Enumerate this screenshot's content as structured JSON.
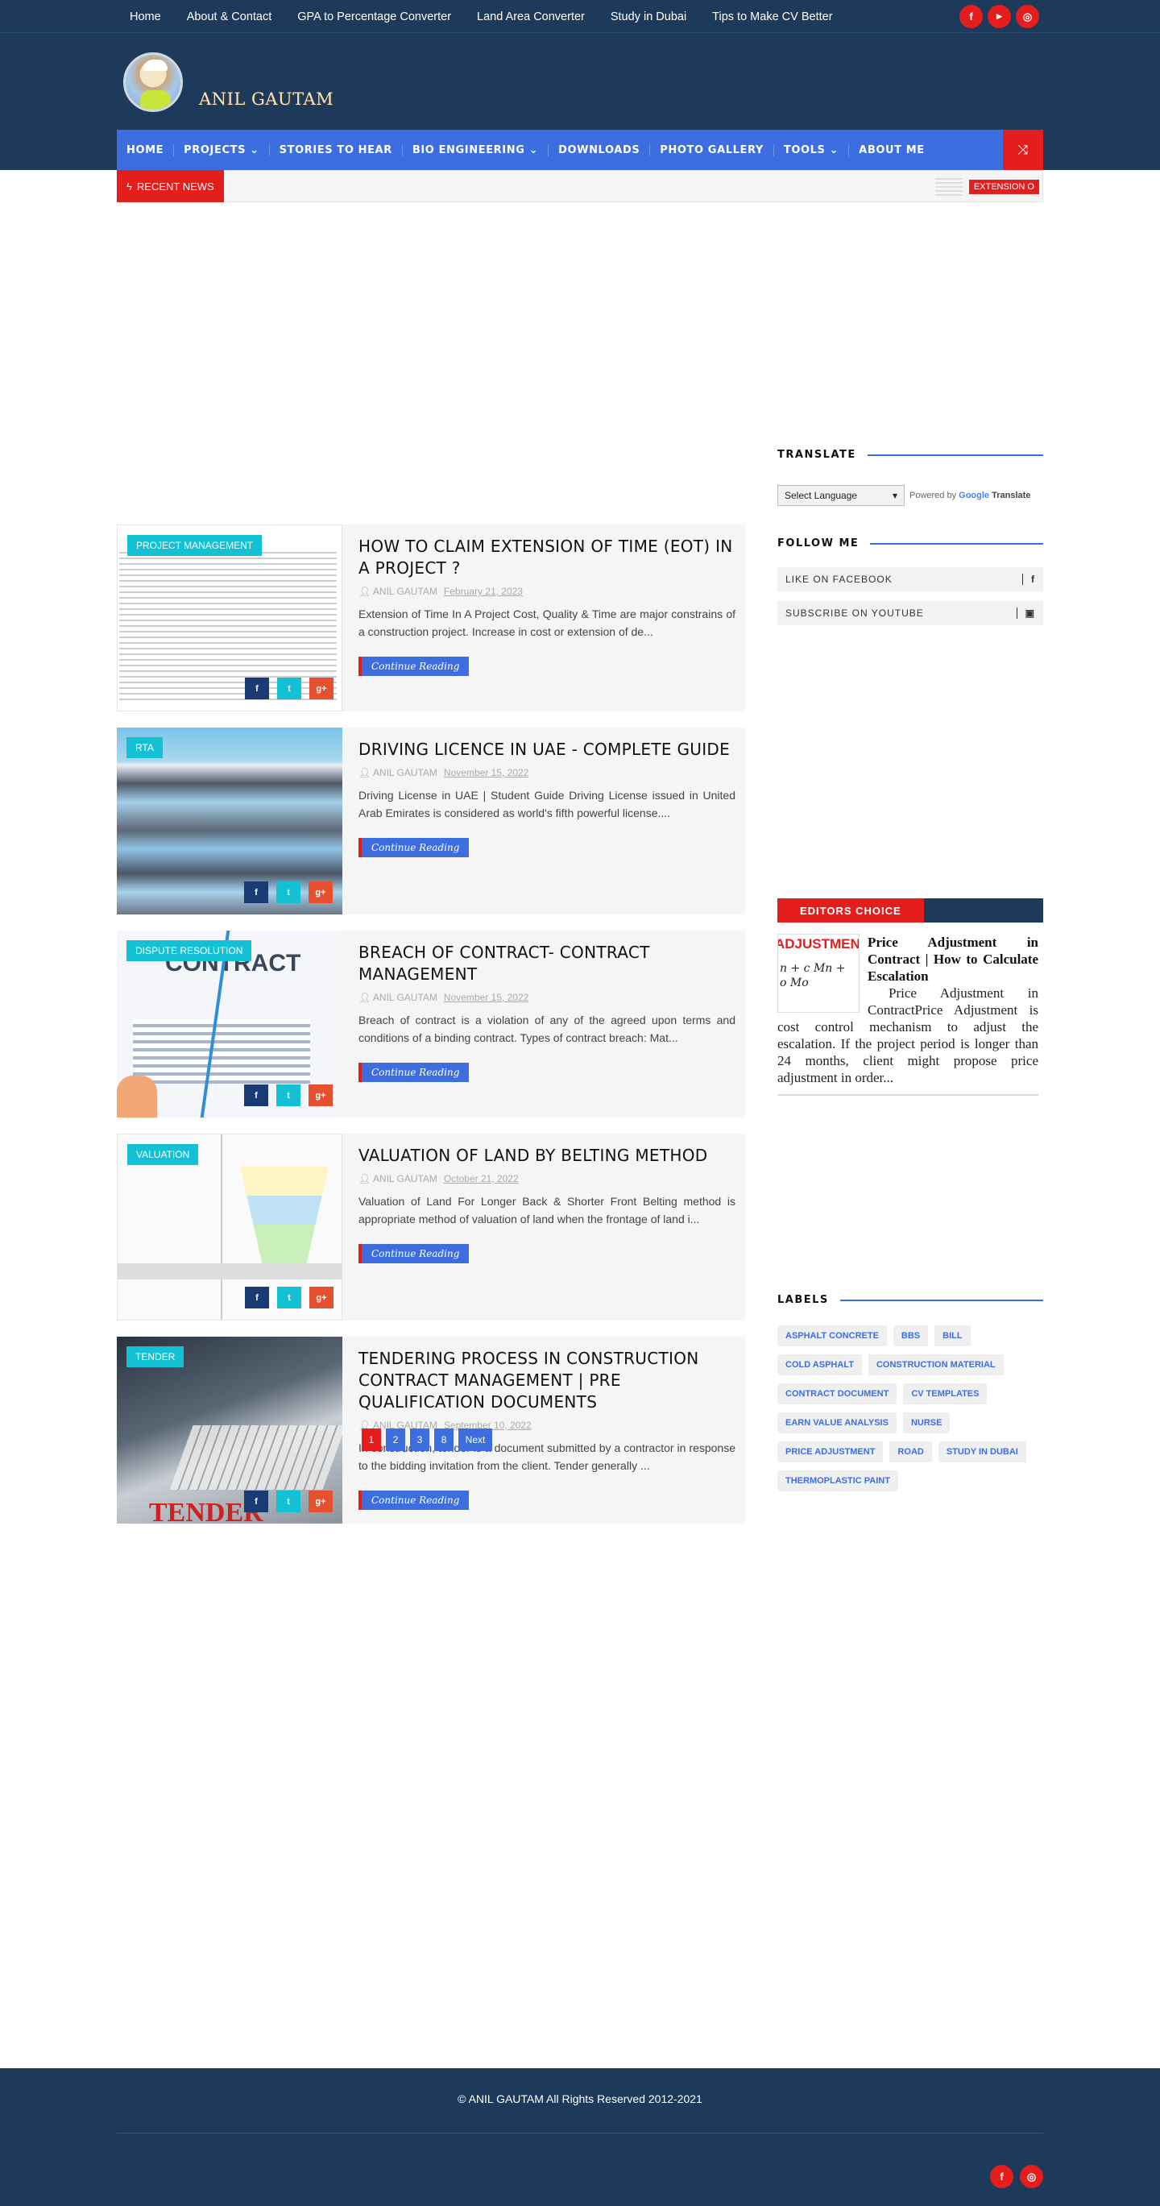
{
  "topbar": {
    "links": [
      "Home",
      "About & Contact",
      "GPA to Percentage Converter",
      "Land Area Converter",
      "Study in Dubai",
      "Tips to Make CV Better"
    ],
    "social": [
      {
        "icon": "facebook-icon",
        "glyph": "f"
      },
      {
        "icon": "youtube-icon",
        "glyph": "▶"
      },
      {
        "icon": "instagram-icon",
        "glyph": "◎"
      }
    ]
  },
  "header": {
    "site_name": "ANIL GAUTAM"
  },
  "nav": {
    "items": [
      "HOME",
      "PROJECTS ⌄",
      "STORIES TO HEAR",
      "BIO ENGINEERING ⌄",
      "DOWNLOADS",
      "PHOTO GALLERY",
      "TOOLS ⌄",
      "ABOUT ME"
    ],
    "shuffle_icon": "shuffle-icon"
  },
  "news": {
    "label": "RECENT NEWS",
    "ticker": "EXTENSION O"
  },
  "posts": [
    {
      "category": "PROJECT MANAGEMENT",
      "title": "HOW TO CLAIM EXTENSION OF TIME (EOT) IN A PROJECT ?",
      "author": "ANIL GAUTAM",
      "date": "February 21, 2023",
      "excerpt": "Extension of Time In A Project Cost, Quality & Time are major constrains of a construction project. Increase in cost or extension of de...",
      "more": "Continue Reading"
    },
    {
      "category": "RTA",
      "title": "DRIVING LICENCE IN UAE - COMPLETE GUIDE",
      "author": "ANIL GAUTAM",
      "date": "November 15, 2022",
      "excerpt": "Driving License in UAE | Student Guide Driving License issued in United Arab Emirates is considered as world's fifth powerful license....",
      "more": "Continue Reading"
    },
    {
      "category": "DISPUTE RESOLUTION",
      "title": "BREACH OF CONTRACT- CONTRACT MANAGEMENT",
      "author": "ANIL GAUTAM",
      "date": "November 15, 2022",
      "excerpt": "Breach of contract is a violation of any of the agreed upon terms and conditions of a binding contract. Types of contract breach: Mat...",
      "more": "Continue Reading"
    },
    {
      "category": "VALUATION",
      "title": "VALUATION OF LAND BY BELTING METHOD",
      "author": "ANIL GAUTAM",
      "date": "October 21, 2022",
      "excerpt": "Valuation of Land For Longer Back & Shorter Front Belting method is appropriate method of valuation of land when the frontage of land i...",
      "more": "Continue Reading"
    },
    {
      "category": "TENDER",
      "title": "TENDERING PROCESS IN CONSTRUCTION CONTRACT MANAGEMENT | PRE QUALIFICATION DOCUMENTS",
      "author": "ANIL GAUTAM",
      "date": "September 10, 2022",
      "excerpt": "In construction, tender is a document submitted by a contractor in response to the bidding invitation from the client. Tender generally ...",
      "more": "Continue Reading"
    }
  ],
  "pager": {
    "pages": [
      "1",
      "2",
      "3",
      "8"
    ],
    "next": "Next"
  },
  "sidebar": {
    "translate": {
      "title": "TRANSLATE",
      "select": "Select Language",
      "powered": "Powered by",
      "google": "Google",
      "translate_word": "Translate"
    },
    "follow": {
      "title": "FOLLOW ME",
      "facebook": "LIKE ON FACEBOOK",
      "youtube": "SUBSCRIBE ON YOUTUBE"
    },
    "editors": {
      "title": "EDITORS CHOICE",
      "img_text": "ADJUSTMENT",
      "img_math": "n + c Mn + ",
      "img_math2": "o      Mo",
      "post_title": "Price Adjustment in Contract | How to Calculate Escalation",
      "excerpt": "Price Adjustment in ContractPrice Adjustment is cost control mechanism to adjust the escalation. If the project period is longer than 24 months, client might propose price adjustment in order..."
    },
    "labels": {
      "title": "LABELS",
      "items": [
        "ASPHALT CONCRETE",
        "BBS",
        "BILL",
        "COLD ASPHALT",
        "CONSTRUCTION MATERIAL",
        "CONTRACT DOCUMENT",
        "CV TEMPLATES",
        "EARN VALUE ANALYSIS",
        "NURSE",
        "PRICE ADJUSTMENT",
        "ROAD",
        "STUDY IN DUBAI",
        "THERMOPLASTIC PAINT"
      ]
    }
  },
  "footer": {
    "copyright": "© ANIL GAUTAM All Rights Reserved 2012-2021"
  },
  "colors": {
    "navy": "#1e3a5a",
    "blue": "#3d6ee0",
    "red": "#e41d1d",
    "cyan": "#14c1d4"
  }
}
